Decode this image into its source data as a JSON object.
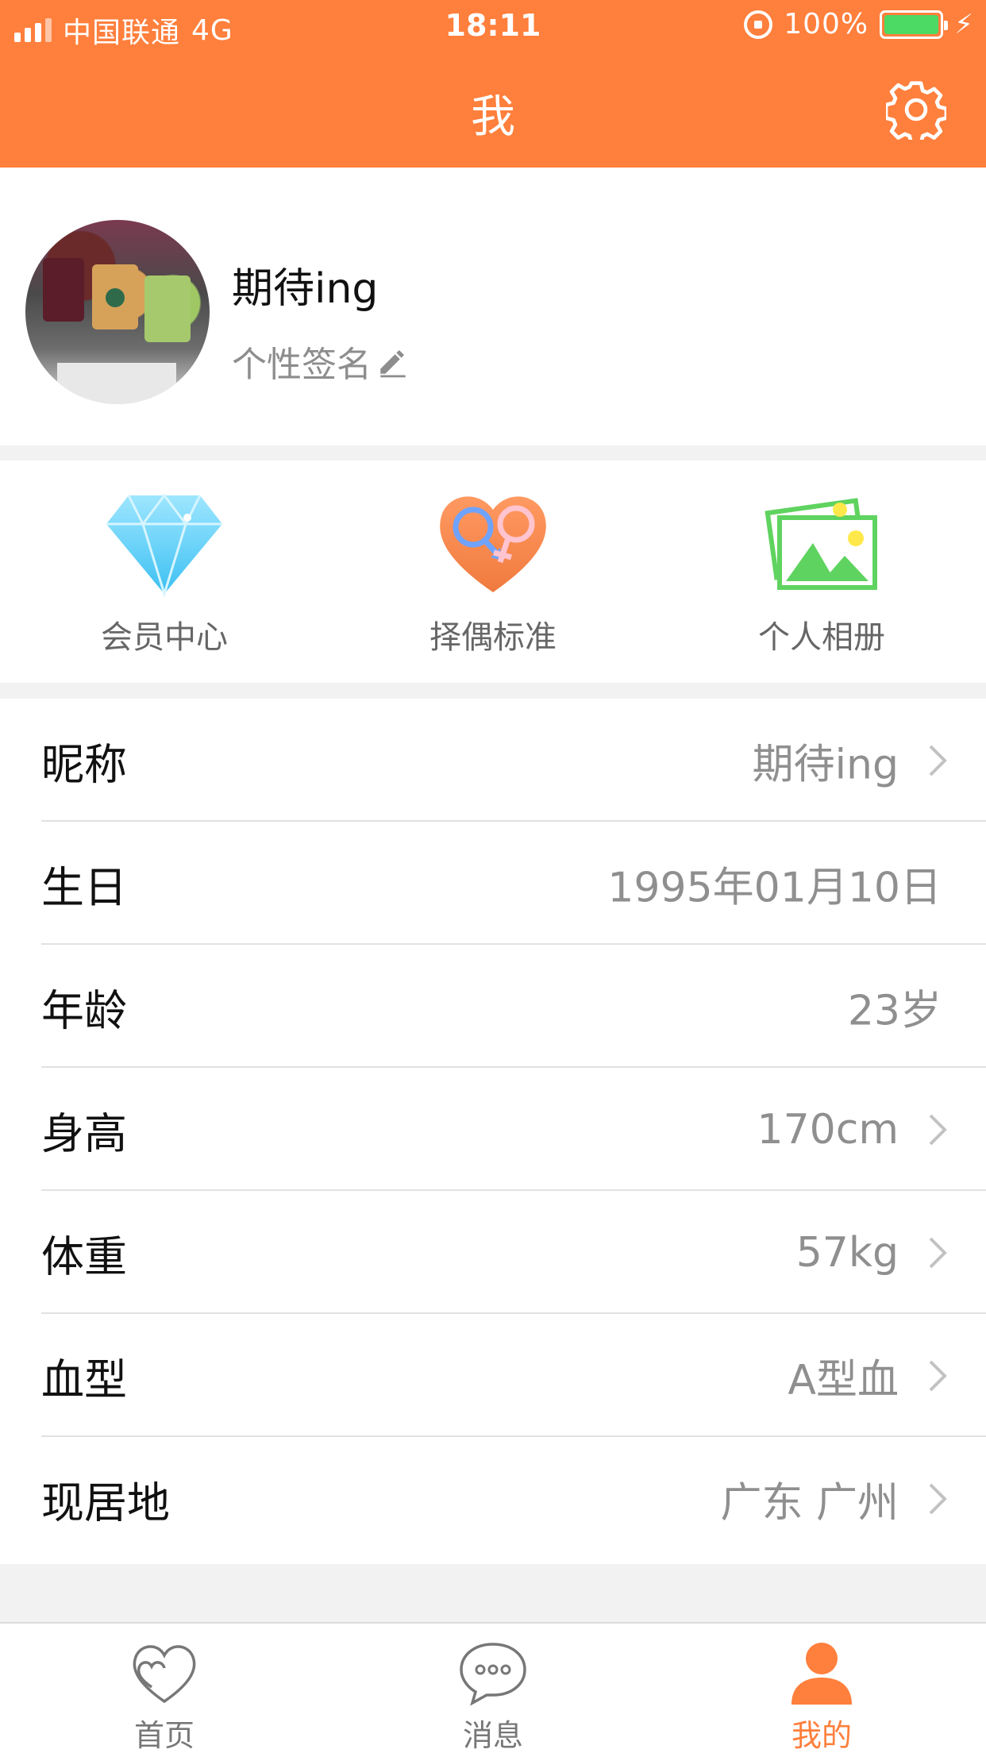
{
  "status_bar": {
    "carrier": "中国联通",
    "network": "4G",
    "time": "18:11",
    "battery": "100%"
  },
  "nav": {
    "title": "我",
    "settings_icon": "gear-icon"
  },
  "profile": {
    "name": "期待ing",
    "signature": "个性签名"
  },
  "quick_menu": [
    {
      "label": "会员中心",
      "icon": "diamond-icon"
    },
    {
      "label": "择偶标准",
      "icon": "gender-heart-icon"
    },
    {
      "label": "个人相册",
      "icon": "photo-album-icon"
    }
  ],
  "info": [
    {
      "label": "昵称",
      "value": "期待ing",
      "arrow": true
    },
    {
      "label": "生日",
      "value": "1995年01月10日",
      "arrow": false
    },
    {
      "label": "年龄",
      "value": "23岁",
      "arrow": false
    },
    {
      "label": "身高",
      "value": "170cm",
      "arrow": true
    },
    {
      "label": "体重",
      "value": "57kg",
      "arrow": true
    },
    {
      "label": "血型",
      "value": "A型血",
      "arrow": true
    },
    {
      "label": "现居地",
      "value": "广东 广州",
      "arrow": true
    }
  ],
  "tabs": [
    {
      "label": "首页",
      "icon": "heart-outline-icon",
      "active": false
    },
    {
      "label": "消息",
      "icon": "chat-bubble-icon",
      "active": false
    },
    {
      "label": "我的",
      "icon": "person-icon",
      "active": true
    }
  ],
  "colors": {
    "accent": "#ff7f3c",
    "battery": "#4cd964"
  }
}
